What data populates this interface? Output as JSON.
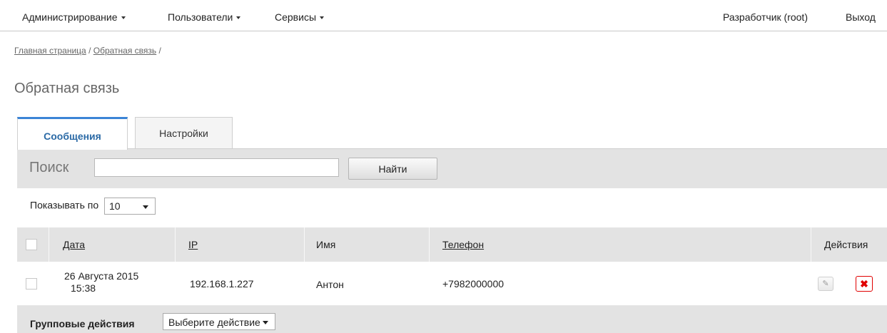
{
  "nav": {
    "menu": [
      {
        "label": "Администрирование"
      },
      {
        "label": "Пользователи"
      },
      {
        "label": "Сервисы"
      }
    ],
    "user": "Разработчик (root)",
    "logout": "Выход"
  },
  "breadcrumb": {
    "home": "Главная страница",
    "separator": " / ",
    "current": "Обратная связь",
    "trailing": " /"
  },
  "page_title": "Обратная связь",
  "tabs": [
    {
      "label": "Сообщения",
      "active": true
    },
    {
      "label": "Настройки",
      "active": false
    }
  ],
  "search": {
    "label": "Поиск",
    "value": "",
    "placeholder": "",
    "button": "Найти"
  },
  "perpage": {
    "label": "Показывать по",
    "value": "10"
  },
  "table": {
    "columns": [
      {
        "label": "Дата",
        "sortable": true
      },
      {
        "label": "IP",
        "sortable": true
      },
      {
        "label": "Имя",
        "sortable": false
      },
      {
        "label": "Телефон",
        "sortable": true
      },
      {
        "label": "Действия",
        "sortable": false
      }
    ],
    "rows": [
      {
        "date_line1": "26 Августа 2015",
        "date_line2": "15:38",
        "ip": "192.168.1.227",
        "name": "Антон",
        "phone": "+7982000000"
      }
    ]
  },
  "bulk_actions": {
    "label": "Групповые действия",
    "select_value": "Выберите действие"
  },
  "colors": {
    "accent": "#3b84d6",
    "delete": "#e00000",
    "panel_bg": "#e3e3e3"
  },
  "icons": {
    "edit": "pencil-icon",
    "delete": "close-icon"
  }
}
